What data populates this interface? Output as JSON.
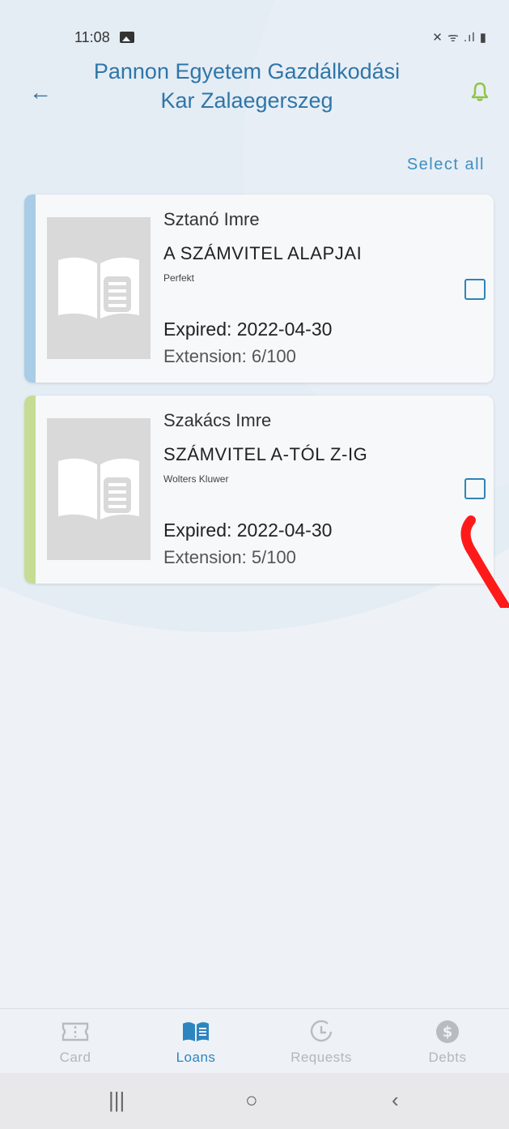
{
  "status": {
    "time": "11:08",
    "icons_text": "✕ ᯤ .ıl ▮"
  },
  "header": {
    "title_line1": "Pannon Egyetem Gazdálkodási",
    "title_line2": "Kar Zalaegerszeg"
  },
  "select_all": "Select all",
  "loans": [
    {
      "author": "Sztanó Imre",
      "title": "A SZÁMVITEL ALAPJAI",
      "publisher": "Perfekt",
      "expired": "Expired: 2022-04-30",
      "extension": "Extension: 6/100",
      "stripe_color": "#a9cde6"
    },
    {
      "author": "Szakács Imre",
      "title": "SZÁMVITEL A-TÓL Z-IG",
      "publisher": "Wolters Kluwer",
      "expired": "Expired: 2022-04-30",
      "extension": "Extension: 5/100",
      "stripe_color": "#c6dc94"
    }
  ],
  "tabs": [
    {
      "label": "Card",
      "icon": "ticket-icon",
      "active": false
    },
    {
      "label": "Loans",
      "icon": "book-icon",
      "active": true
    },
    {
      "label": "Requests",
      "icon": "clock-icon",
      "active": false
    },
    {
      "label": "Debts",
      "icon": "dollar-icon",
      "active": false
    }
  ],
  "navbar": {
    "recents": "|||",
    "home": "○",
    "back": "‹"
  },
  "colors": {
    "accent": "#2d85c0",
    "bell": "#8dc63f",
    "annotation": "#ff1a1a"
  }
}
